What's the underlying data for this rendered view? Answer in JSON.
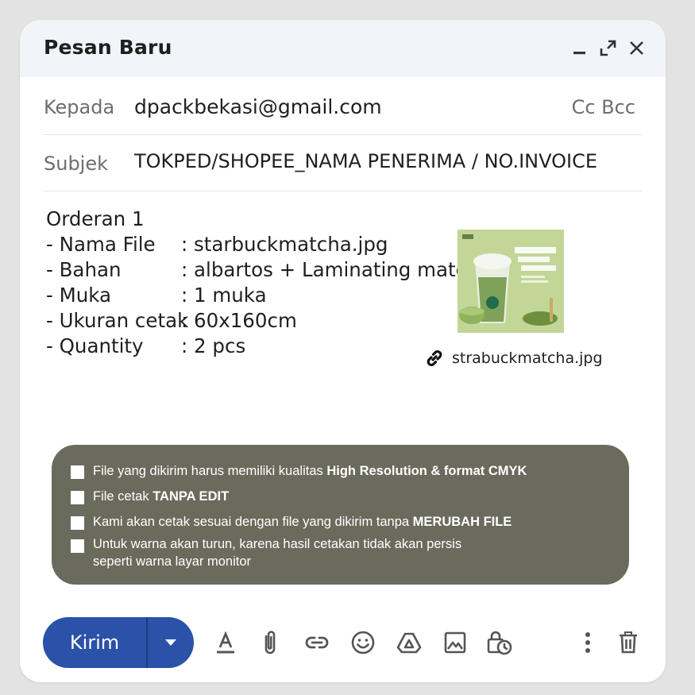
{
  "window": {
    "title": "Pesan Baru"
  },
  "icons": {
    "minimize": "minimize-icon",
    "expand": "expand-icon",
    "close": "close-icon",
    "attachment_link": "link-icon",
    "format": "text-format-icon",
    "attach": "paperclip-icon",
    "insert_link": "insert-link-icon",
    "emoji": "emoji-icon",
    "drive": "drive-icon",
    "photo": "photo-icon",
    "confidential": "lock-clock-icon",
    "more": "more-vertical-icon",
    "discard": "trash-icon"
  },
  "to": {
    "label": "Kepada",
    "value": "dpackbekasi@gmail.com",
    "cc_bcc": "Cc Bcc"
  },
  "subject": {
    "label": "Subjek",
    "value": "TOKPED/SHOPEE_NAMA PENERIMA / NO.INVOICE"
  },
  "body": {
    "heading": "Orderan 1",
    "rows": [
      {
        "key": "- Nama File",
        "value": ": starbuckmatcha.jpg"
      },
      {
        "key": "- Bahan",
        "value": ": albartos + Laminating mate"
      },
      {
        "key": "- Muka",
        "value": ": 1 muka"
      },
      {
        "key": "- Ukuran cetak",
        "value": ": 60x160cm"
      },
      {
        "key": "- Quantity",
        "value": ": 2 pcs"
      }
    ]
  },
  "attachment": {
    "filename": "strabuckmatcha.jpg"
  },
  "notes": [
    {
      "text": "File yang dikirim harus memiliki kualitas ",
      "bold": "High Resolution & format CMYK"
    },
    {
      "text": "File cetak ",
      "bold": "TANPA EDIT"
    },
    {
      "text": "Kami akan cetak sesuai dengan file yang dikirim tanpa ",
      "bold": "MERUBAH FILE"
    },
    {
      "text": "Untuk warna akan turun, karena hasil cetakan tidak akan persis",
      "line2": "seperti warna layar monitor"
    }
  ],
  "toolbar": {
    "send_label": "Kirim"
  },
  "colors": {
    "send": "#2b52a8",
    "notes_bg": "#6b6b5d",
    "titlebar": "#f1f4f9"
  }
}
